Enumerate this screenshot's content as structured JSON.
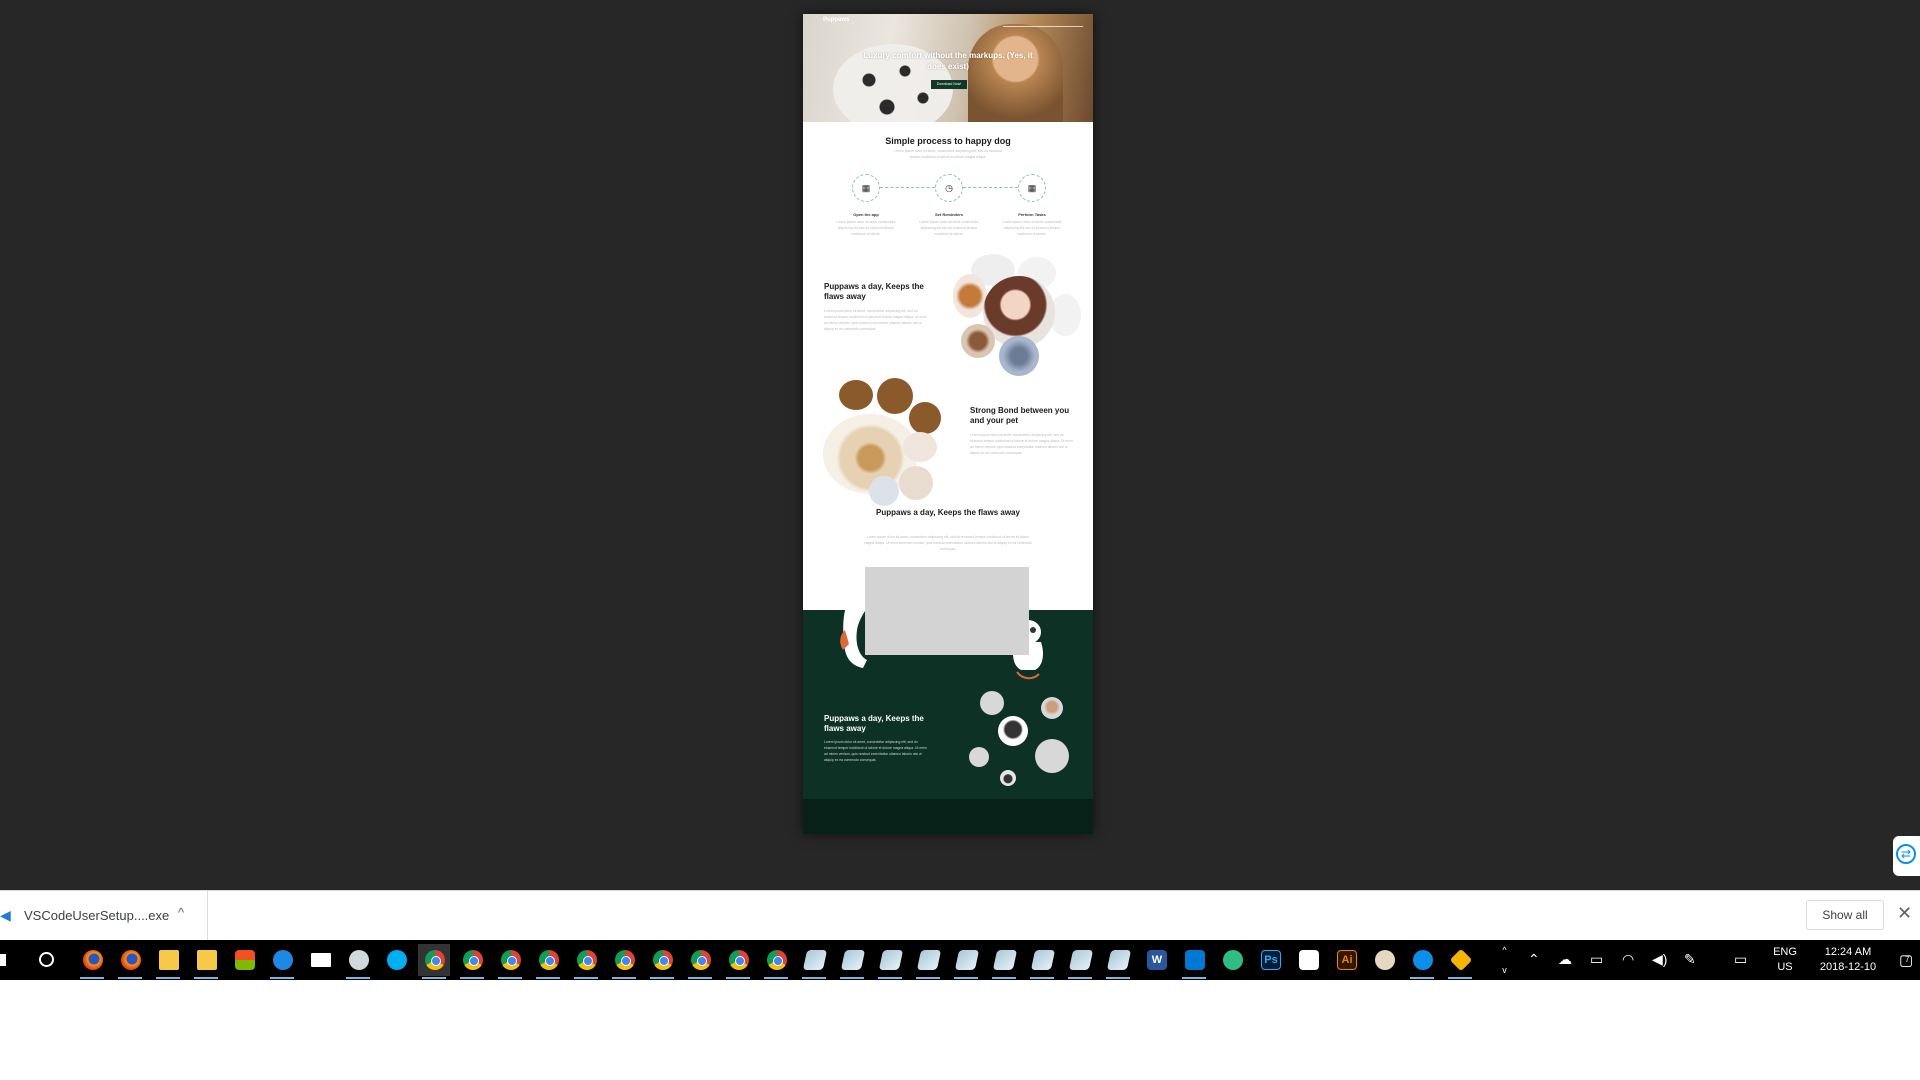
{
  "preview": {
    "hero": {
      "logo": "Puppaws",
      "tagline": "Luxury comfort without the markups. (Yes, it does exist)",
      "cta": "Download Now!"
    },
    "process": {
      "title": "Simple process to happy dog",
      "subtitle": "Lorem ipsum dolor sit amet, consectetur adipiscing elit, sed do eiusmod tempor incididunt ut labore et dolore magna aliqua.",
      "steps": [
        {
          "label": "Open the app",
          "text": "Lorem ipsum dolor sit amet consectetur adipiscing elit sed do eiusmod tempor incididunt ut labore.",
          "icon": "calendar-icon",
          "glyph": "▦"
        },
        {
          "label": "Set Reminders",
          "text": "Lorem ipsum dolor sit amet consectetur adipiscing elit sed do eiusmod tempor incididunt ut labore.",
          "icon": "clock-icon",
          "glyph": "◷"
        },
        {
          "label": "Perform Tasks",
          "text": "Lorem ipsum dolor sit amet consectetur adipiscing elit sed do eiusmod tempor incididunt ut labore.",
          "icon": "calendar-icon",
          "glyph": "▦"
        }
      ]
    },
    "feature1": {
      "title": "Puppaws a day, Keeps the flaws away",
      "text": "Lorem ipsum dolor sit amet, consectetur adipiscing elit, sed do eiusmod tempor incididunt ut labore et dolore magna aliqua. Ut enim ad minim veniam, quis nostrud exercitation ullamco laboris nisi ut aliquip ex ea commodo consequat."
    },
    "feature2": {
      "title": "Strong Bond between you and your pet",
      "text": "Lorem ipsum dolor sit amet, consectetur adipiscing elit, sed do eiusmod tempor incididunt ut labore et dolore magna aliqua. Ut enim ad minim veniam, quis nostrud exercitation ullamco laboris nisi ut aliquip ex ea commodo consequat."
    },
    "feature3": {
      "title": "Puppaws a day, Keeps the flaws away",
      "text": "Lorem ipsum dolor sit amet, consectetur adipiscing elit, sed do eiusmod tempor incididunt ut labore et dolore magna aliqua. Ut enim ad minim veniam, quis nostrud exercitation ullamco laboris nisi ut aliquip ex ea commodo consequat."
    },
    "feature4": {
      "title": "Puppaws a day, Keeps the flaws away",
      "text": "Lorem ipsum dolor sit amet, consectetur adipiscing elit, sed do eiusmod tempor incididunt ut labore et dolore magna aliqua. Ut enim ad minim veniam, quis nostrud exercitation ullamco laboris nisi ut aliquip ex ea commodo consequat."
    },
    "colors": {
      "accent": "#0e3125",
      "dashed": "#7fc6a4",
      "viewer_bg": "#272727"
    }
  },
  "download_bar": {
    "file_name": "VSCodeUserSetup....exe",
    "caret": "^",
    "show_all": "Show all",
    "close": "✕"
  },
  "side_widget": {
    "glyph": "⇄",
    "icon": "teamviewer-icon"
  },
  "taskbar": {
    "apps": [
      "firefox",
      "firefox",
      "file-explorer",
      "file-explorer",
      "microsoft-store",
      "edge",
      "mail",
      "steam",
      "skype",
      "chrome",
      "chrome",
      "chrome",
      "chrome",
      "chrome",
      "chrome",
      "chrome",
      "chrome",
      "chrome",
      "chrome",
      "file",
      "file",
      "file",
      "file",
      "file",
      "file",
      "file",
      "file",
      "file",
      "word",
      "vscode",
      "spotify",
      "photoshop",
      "photos",
      "illustrator",
      "paint",
      "teamviewer",
      "gitkraken"
    ],
    "word_label": "W",
    "ps_label": "Ps",
    "ai_label": "Ai",
    "scroll_up": "^",
    "scroll_down": "v",
    "tray": {
      "language_top": "ENG",
      "language_bottom": "US",
      "time": "12:24 AM",
      "date": "2018-12-10",
      "notification_count": "7"
    }
  }
}
